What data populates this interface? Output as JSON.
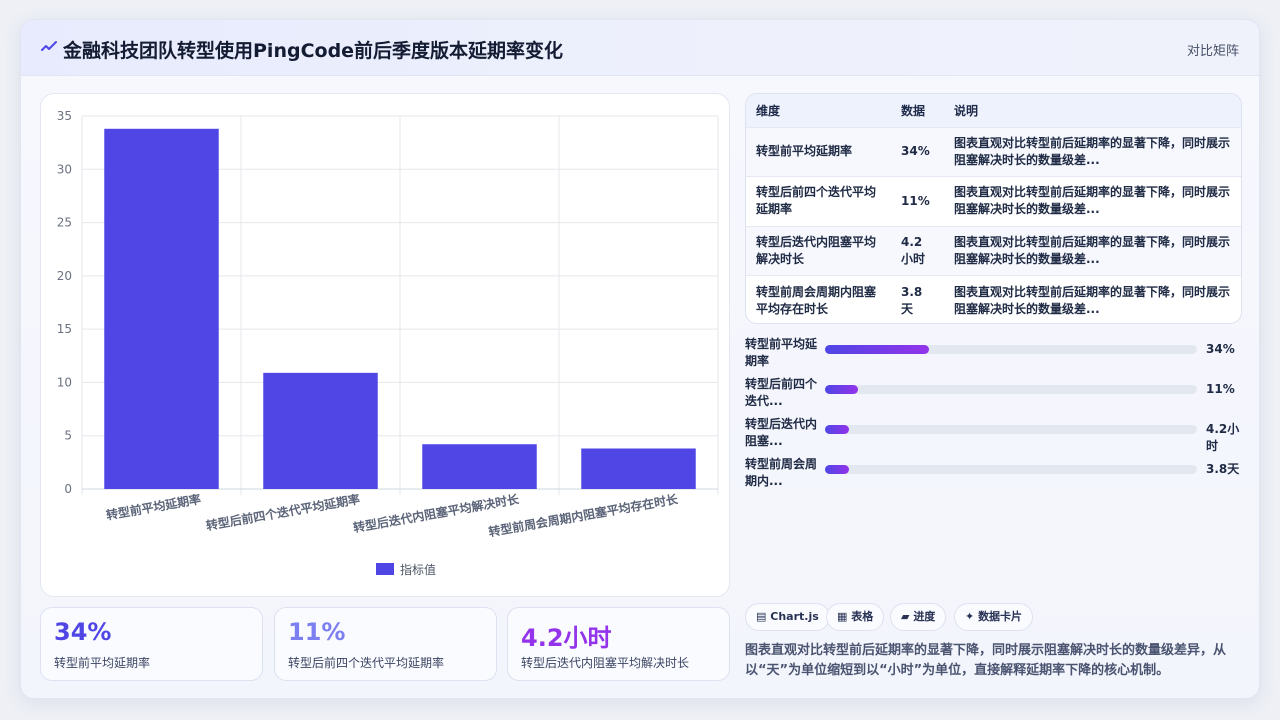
{
  "header": {
    "icon": "sparkline-icon",
    "title": "金融科技团队转型使用PingCode前后季度版本延期率变化",
    "view_label": "对比矩阵"
  },
  "chart_data": {
    "type": "bar",
    "categories": [
      "转型前平均延期率",
      "转型后前四个迭代平均延期率",
      "转型后迭代内阻塞平均解决时长",
      "转型前周会周期内阻塞平均存在时长"
    ],
    "series": [
      {
        "name": "指标值",
        "values": [
          33.8,
          10.9,
          4.2,
          3.8
        ],
        "color": "#4f46e5"
      }
    ],
    "ylim": [
      0,
      35
    ],
    "yticks": [
      0,
      5,
      10,
      15,
      20,
      25,
      30,
      35
    ],
    "grid": true,
    "legend": "bottom-center"
  },
  "table": {
    "headers": [
      "维度",
      "数据",
      "说明"
    ],
    "rows": [
      [
        "转型前平均延期率",
        "34%",
        "图表直观对比转型前后延期率的显著下降，同时展示阻塞解决时长的数量级差..."
      ],
      [
        "转型后前四个迭代平均延期率",
        "11%",
        "图表直观对比转型前后延期率的显著下降，同时展示阻塞解决时长的数量级差..."
      ],
      [
        "转型后迭代内阻塞平均解决时长",
        "4.2小时",
        "图表直观对比转型前后延期率的显著下降，同时展示阻塞解决时长的数量级差..."
      ],
      [
        "转型前周会周期内阻塞平均存在时长",
        "3.8天",
        "图表直观对比转型前后延期率的显著下降，同时展示阻塞解决时长的数量级差..."
      ]
    ]
  },
  "progress": [
    {
      "label": "转型前平均延期率",
      "value": "34%",
      "fraction": 0.28
    },
    {
      "label": "转型后前四个迭代...",
      "value": "11%",
      "fraction": 0.09
    },
    {
      "label": "转型后迭代内阻塞...",
      "value": "4.2小时",
      "fraction": 0.065
    },
    {
      "label": "转型前周会周期内...",
      "value": "3.8天",
      "fraction": 0.065
    }
  ],
  "tags": [
    {
      "icon": "chart-icon",
      "glyph": "▤",
      "label": "Chart.js"
    },
    {
      "icon": "table-icon",
      "glyph": "▦",
      "label": "表格"
    },
    {
      "icon": "progress-icon",
      "glyph": "▰",
      "label": "进度"
    },
    {
      "icon": "sparkle-icon",
      "glyph": "✦",
      "label": "数据卡片"
    }
  ],
  "description": "图表直观对比转型前后延期率的显著下降，同时展示阻塞解决时长的数量级差异，从以“天”为单位缩短到以“小时”为单位，直接解释延期率下降的核心机制。",
  "kpis": [
    {
      "value": "34%",
      "label": "转型前平均延期率",
      "color": "#4f46e5"
    },
    {
      "value": "11%",
      "label": "转型后前四个迭代平均延期率",
      "color": "#7c7ff0"
    },
    {
      "value": "4.2小时",
      "label": "转型后迭代内阻塞平均解决时长",
      "color": "#9333ea"
    }
  ]
}
